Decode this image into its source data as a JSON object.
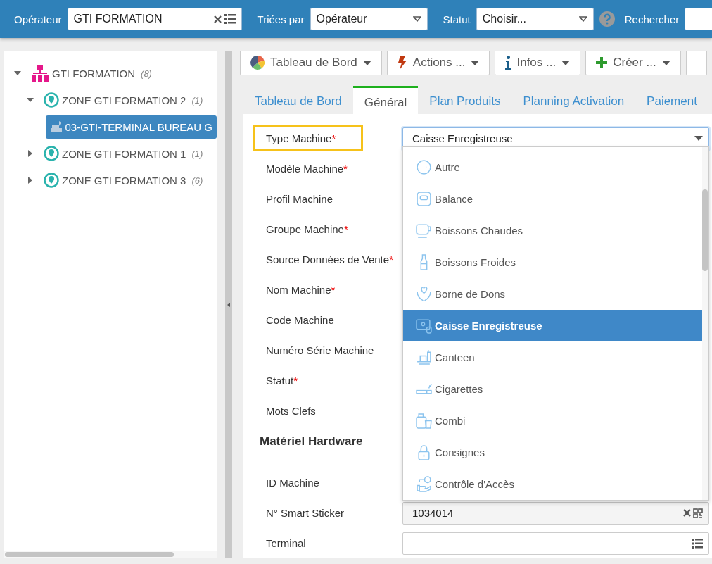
{
  "filter_bar": {
    "operator": {
      "label": "Opérateur",
      "value": "GTI FORMATION"
    },
    "sort": {
      "label": "Triées par",
      "value": "Opérateur"
    },
    "status": {
      "label": "Statut",
      "value": "Choisir..."
    },
    "search": {
      "label": "Rechercher"
    }
  },
  "tree": [
    {
      "label": "GTI FORMATION",
      "count": "(8)",
      "kind": "organisation",
      "expanded": true,
      "selected": false,
      "children": [
        {
          "label": "ZONE GTI FORMATION 2",
          "count": "(1)",
          "kind": "zone",
          "expanded": true,
          "selected": false,
          "children": [
            {
              "label": "03-GTI-TERMINAL BUREAU G",
              "kind": "machine",
              "selected": true
            }
          ]
        },
        {
          "label": "ZONE GTI FORMATION 1",
          "count": "(1)",
          "kind": "zone",
          "expanded": false,
          "selected": false
        },
        {
          "label": "ZONE GTI FORMATION 3",
          "count": "(6)",
          "kind": "zone",
          "expanded": false,
          "selected": false
        }
      ]
    }
  ],
  "toolbar": [
    {
      "label": "Tableau de Bord",
      "kind": "dashboard"
    },
    {
      "label": "Actions ...",
      "kind": "actions"
    },
    {
      "label": "Infos ...",
      "kind": "info"
    },
    {
      "label": "Créer ...",
      "kind": "create"
    }
  ],
  "tabs": [
    {
      "label": "Tableau de Bord",
      "selected": false
    },
    {
      "label": "Général",
      "selected": true
    },
    {
      "label": "Plan Produits",
      "selected": false
    },
    {
      "label": "Planning Activation",
      "selected": false
    },
    {
      "label": "Paiement",
      "selected": false
    }
  ],
  "form": [
    {
      "kind": "field",
      "label": "Type Machine",
      "required_mark": "*",
      "highlighted": true,
      "field": {
        "kind": "select",
        "value": "Caisse Enregistreuse"
      }
    },
    {
      "kind": "field",
      "label": "Modèle Machine",
      "required_mark": "*",
      "highlighted": false
    },
    {
      "kind": "field",
      "label": "Profil Machine",
      "highlighted": false
    },
    {
      "kind": "field",
      "label": "Groupe Machine",
      "required_mark": "*",
      "highlighted": false
    },
    {
      "kind": "field",
      "label": "Source Données de Vente",
      "required_mark": "*",
      "highlighted": false
    },
    {
      "kind": "field",
      "label": "Nom Machine",
      "required_mark": "*",
      "highlighted": false
    },
    {
      "kind": "field",
      "label": "Code Machine",
      "highlighted": false
    },
    {
      "kind": "field",
      "label": "Numéro Série Machine",
      "highlighted": false
    },
    {
      "kind": "field",
      "label": "Statut",
      "required_mark": "*",
      "highlighted": false
    },
    {
      "kind": "field",
      "label": "Mots Clefs",
      "highlighted": false
    },
    {
      "kind": "heading",
      "label": "Matériel Hardware"
    },
    {
      "kind": "field",
      "label": "ID Machine",
      "highlighted": false
    },
    {
      "kind": "field",
      "label": "N° Smart Sticker",
      "highlighted": false,
      "field": {
        "kind": "qr",
        "value": "1034014"
      }
    },
    {
      "kind": "field",
      "label": "Terminal",
      "highlighted": false,
      "field": {
        "kind": "list"
      }
    }
  ],
  "dropdown": {
    "items": [
      {
        "label": "Autre",
        "selected": false
      },
      {
        "label": "Balance",
        "selected": false
      },
      {
        "label": "Boissons Chaudes",
        "selected": false
      },
      {
        "label": "Boissons Froides",
        "selected": false
      },
      {
        "label": "Borne de Dons",
        "selected": false
      },
      {
        "label": "Caisse Enregistreuse",
        "selected": true
      },
      {
        "label": "Canteen",
        "selected": false
      },
      {
        "label": "Cigarettes",
        "selected": false
      },
      {
        "label": "Combi",
        "selected": false
      },
      {
        "label": "Consignes",
        "selected": false
      },
      {
        "label": "Contrôle d'Accès",
        "selected": false
      }
    ]
  }
}
